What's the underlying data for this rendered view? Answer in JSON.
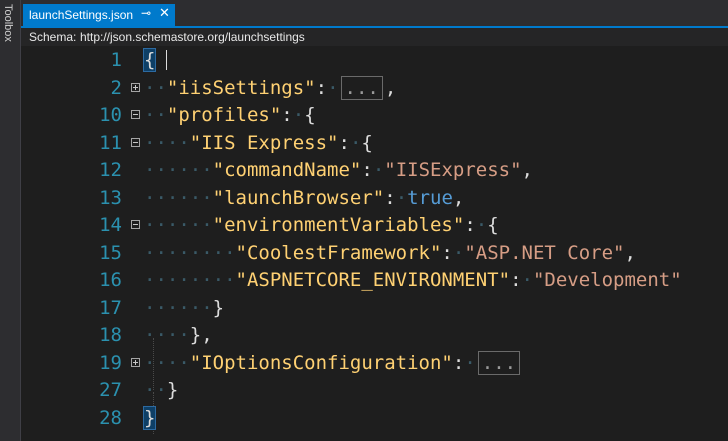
{
  "toolbox": {
    "label": "Toolbox"
  },
  "tab": {
    "title": "launchSettings.json",
    "pin_icon": "⊸",
    "close_icon": "✕"
  },
  "schema": {
    "label": "Schema:",
    "url": "http://json.schemastore.org/launchsettings"
  },
  "lines": [
    {
      "num": "1",
      "fold": "",
      "indent": "",
      "parts": [
        {
          "c": "brace-hl",
          "t": "{"
        }
      ]
    },
    {
      "num": "2",
      "fold": "plus",
      "indent": "··",
      "parts": [
        {
          "c": "key",
          "t": "\"iisSettings\""
        },
        {
          "c": "punc",
          "t": ":"
        },
        {
          "c": "ws",
          "t": "·"
        },
        {
          "c": "collapsed",
          "t": "..."
        },
        {
          "c": "punc",
          "t": ","
        }
      ]
    },
    {
      "num": "10",
      "fold": "minus",
      "indent": "··",
      "parts": [
        {
          "c": "key",
          "t": "\"profiles\""
        },
        {
          "c": "punc",
          "t": ":"
        },
        {
          "c": "ws",
          "t": "·"
        },
        {
          "c": "punc",
          "t": "{"
        }
      ]
    },
    {
      "num": "11",
      "fold": "minus",
      "indent": "····",
      "parts": [
        {
          "c": "key",
          "t": "\"IIS Express\""
        },
        {
          "c": "punc",
          "t": ":"
        },
        {
          "c": "ws",
          "t": "·"
        },
        {
          "c": "punc",
          "t": "{"
        }
      ]
    },
    {
      "num": "12",
      "fold": "",
      "indent": "······",
      "parts": [
        {
          "c": "key",
          "t": "\"commandName\""
        },
        {
          "c": "punc",
          "t": ":"
        },
        {
          "c": "ws",
          "t": "·"
        },
        {
          "c": "str",
          "t": "\"IISExpress\""
        },
        {
          "c": "punc",
          "t": ","
        }
      ]
    },
    {
      "num": "13",
      "fold": "",
      "indent": "······",
      "parts": [
        {
          "c": "key",
          "t": "\"launchBrowser\""
        },
        {
          "c": "punc",
          "t": ":"
        },
        {
          "c": "ws",
          "t": "·"
        },
        {
          "c": "kw",
          "t": "true"
        },
        {
          "c": "punc",
          "t": ","
        }
      ]
    },
    {
      "num": "14",
      "fold": "minus",
      "indent": "······",
      "parts": [
        {
          "c": "key",
          "t": "\"environmentVariables\""
        },
        {
          "c": "punc",
          "t": ":"
        },
        {
          "c": "ws",
          "t": "·"
        },
        {
          "c": "punc",
          "t": "{"
        }
      ]
    },
    {
      "num": "15",
      "fold": "",
      "indent": "········",
      "parts": [
        {
          "c": "key",
          "t": "\"CoolestFramework\""
        },
        {
          "c": "punc",
          "t": ":"
        },
        {
          "c": "ws",
          "t": "·"
        },
        {
          "c": "str",
          "t": "\"ASP.NET Core\""
        },
        {
          "c": "punc",
          "t": ","
        }
      ]
    },
    {
      "num": "16",
      "fold": "",
      "indent": "········",
      "parts": [
        {
          "c": "key",
          "t": "\"ASPNETCORE_ENVIRONMENT\""
        },
        {
          "c": "punc",
          "t": ":"
        },
        {
          "c": "ws",
          "t": "·"
        },
        {
          "c": "str",
          "t": "\"Development\""
        }
      ]
    },
    {
      "num": "17",
      "fold": "",
      "indent": "······",
      "parts": [
        {
          "c": "punc",
          "t": "}"
        }
      ]
    },
    {
      "num": "18",
      "fold": "",
      "indent": "····",
      "parts": [
        {
          "c": "punc",
          "t": "},"
        }
      ]
    },
    {
      "num": "19",
      "fold": "plus",
      "indent": "····",
      "parts": [
        {
          "c": "key",
          "t": "\"IOptionsConfiguration\""
        },
        {
          "c": "punc",
          "t": ":"
        },
        {
          "c": "ws",
          "t": "·"
        },
        {
          "c": "collapsed",
          "t": "..."
        }
      ]
    },
    {
      "num": "27",
      "fold": "",
      "indent": "··",
      "parts": [
        {
          "c": "punc",
          "t": "}"
        }
      ]
    },
    {
      "num": "28",
      "fold": "",
      "indent": "",
      "parts": [
        {
          "c": "brace-hl",
          "t": "}"
        }
      ]
    }
  ],
  "colors": {
    "accent": "#007acc",
    "line_number": "#2b91af",
    "key": "#ffd173",
    "string": "#d69d85",
    "keyword": "#569cd6"
  }
}
